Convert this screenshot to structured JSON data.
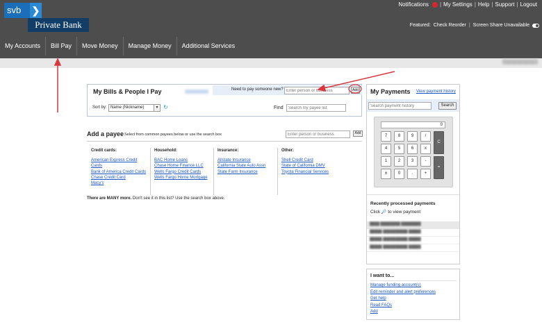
{
  "brand": {
    "svb": "svb",
    "chevron": "❯",
    "sub": "Private Bank"
  },
  "top_links": [
    "Notifications",
    "My Settings",
    "Help",
    "Support",
    "Logout"
  ],
  "featured": {
    "label": "Featured:",
    "items": [
      "Check Reorder",
      "Screen Share Unavailable"
    ]
  },
  "nav": [
    "My Accounts",
    "Bill Pay",
    "Move Money",
    "Manage Money",
    "Additional Services"
  ],
  "bills": {
    "title": "My Bills & People I Pay",
    "pay_prompt": "Need to pay someone new?",
    "pay_placeholder": "Enter person or business",
    "add_button": "Add",
    "sort_label": "Sort by:",
    "sort_value": "Name (Nickname)",
    "find_label": "Find",
    "find_placeholder": "Search my payee list"
  },
  "add_payee": {
    "title": "Add a payee",
    "subtitle": "Select from common payees below or use the search box",
    "placeholder": "Enter person or business",
    "add_button": "Add",
    "categories": [
      {
        "heading": "Credit cards:",
        "links": [
          "American Express Credit Cards",
          "Bank of America Credit Cards",
          "Chase Credit Card",
          "Macy's"
        ]
      },
      {
        "heading": "Household:",
        "links": [
          "BAC Home Loans",
          "Chase Home Finance LLC",
          "Wells Fargo Credit Cards",
          "Wells Fargo Home Mortgage"
        ]
      },
      {
        "heading": "Insurance:",
        "links": [
          "Allstate Insurance",
          "California State Auto Assn",
          "State Farm Insurance"
        ]
      },
      {
        "heading": "Other:",
        "links": [
          "Shell Credit Card",
          "State of California DMV",
          "Toyota Financial Services"
        ]
      }
    ],
    "more_bold": "There are MANY more.",
    "more_rest": " Don't see it in this list? Use the search box above."
  },
  "payments": {
    "title": "My Payments",
    "history_link": "View payment history",
    "search_placeholder": "Search payment history",
    "search_button": "Search",
    "calc_display": "0",
    "calc_keys": {
      "row1": [
        "7",
        "8",
        "9",
        "/"
      ],
      "row2": [
        "4",
        "5",
        "6",
        "x"
      ],
      "row3": [
        "1",
        "2",
        "3",
        "-"
      ],
      "row4": [
        "±",
        "0",
        ".",
        "+"
      ],
      "clear": "C",
      "equals": "="
    },
    "recent_title": "Recently processed payments",
    "recent_hint_pre": "Click",
    "recent_hint_post": "to view payment"
  },
  "iwant": {
    "title": "I want to...",
    "links": [
      "Manage funding account(s)",
      "Edit reminder and alert preferences",
      "Get help",
      "Read FAQs",
      "Add"
    ]
  },
  "colors": {
    "header": "#4d4d4d",
    "accent_blue": "#1a6fb8",
    "navy": "#123d66",
    "link": "#1a55c4",
    "alert_red": "#d8262f"
  },
  "icons": [
    "notification-dot-icon",
    "toggle-icon",
    "refresh-icon",
    "zoom-icon",
    "dropdown-arrow-icon"
  ]
}
